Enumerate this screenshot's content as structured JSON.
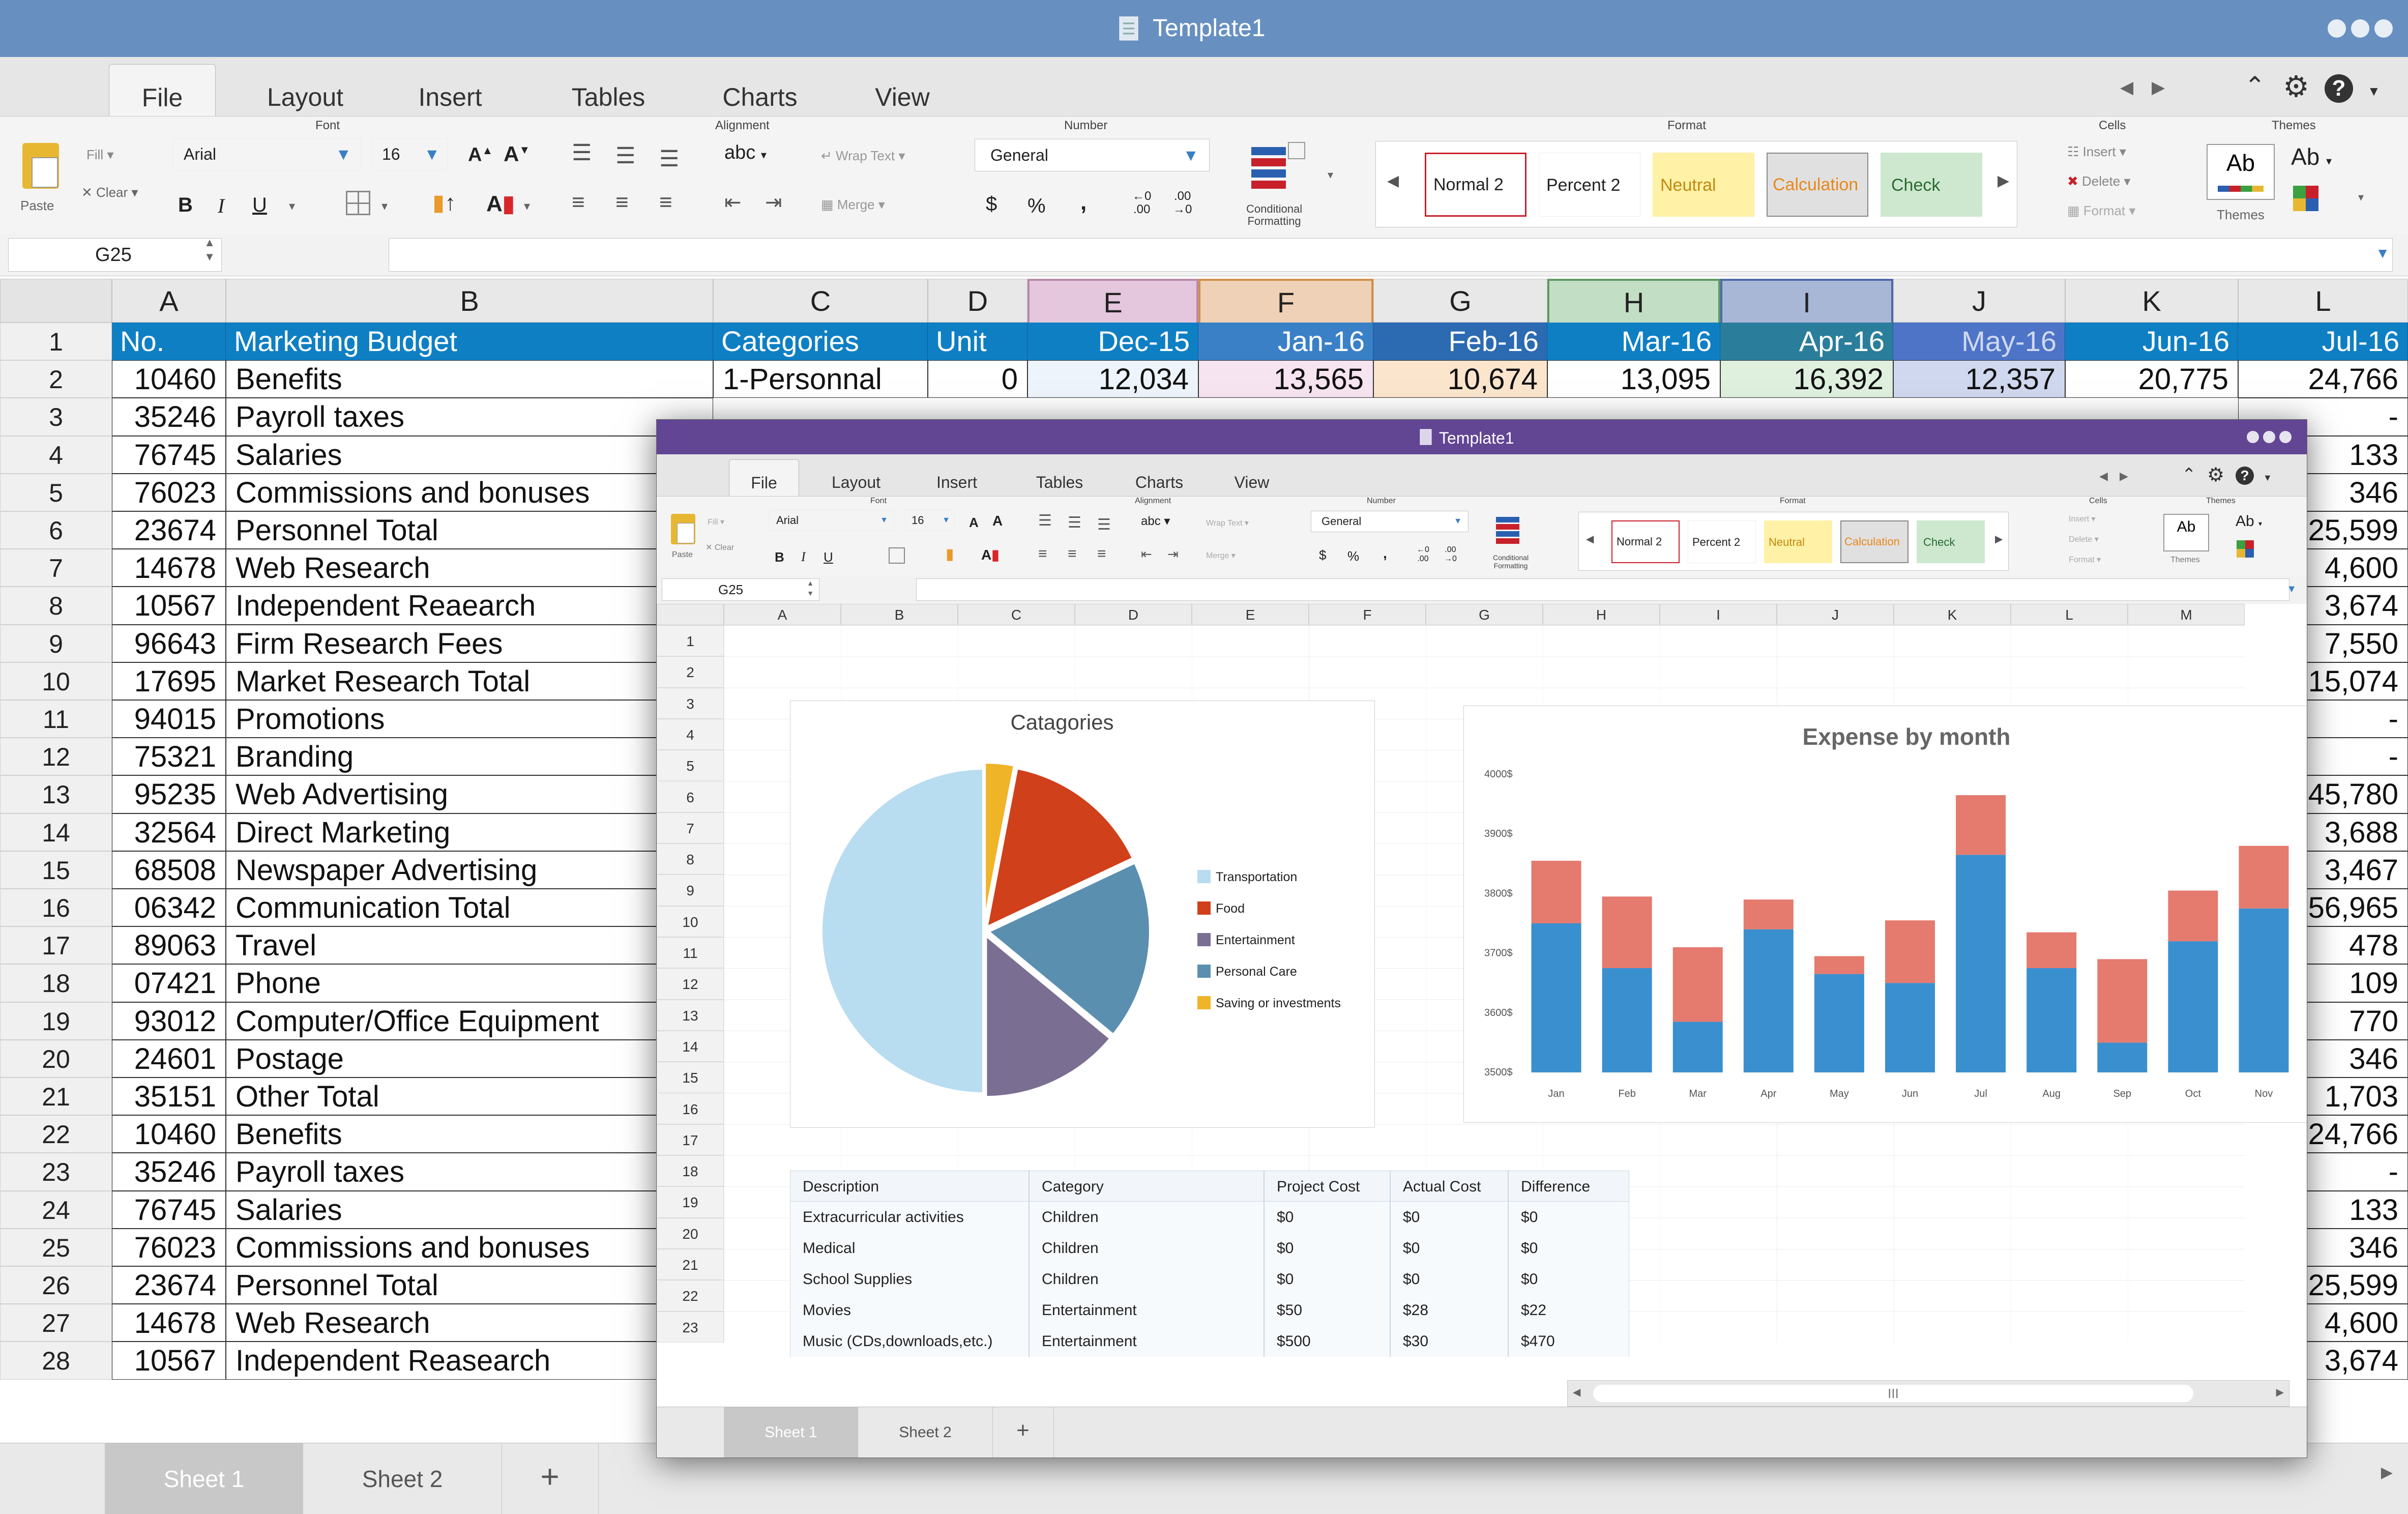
{
  "main": {
    "title": "Template1",
    "tabs": [
      "File",
      "Layout",
      "Insert",
      "Tables",
      "Charts",
      "View"
    ],
    "ribbon": {
      "group_labels": {
        "font": "Font",
        "alignment": "Alignment",
        "number": "Number",
        "format": "Format",
        "cells": "Cells",
        "themes": "Themes"
      },
      "paste_label": "Paste",
      "fill_label": "Fill",
      "clear_label": "Clear",
      "font_family": "Arial",
      "font_size": "16",
      "wrap_label": "Wrap Text",
      "merge_label": "Merge",
      "orient_label": "abc",
      "number_format": "General",
      "cond_label_1": "Conditional",
      "cond_label_2": "Formatting",
      "styles": [
        "Normal 2",
        "Percent 2",
        "Neutral",
        "Calculation",
        "Check"
      ],
      "insert_label": "Insert",
      "delete_label": "Delete",
      "format_label": "Format",
      "themes_label": "Themes",
      "ab_label": "Ab"
    },
    "name_box": "G25",
    "columns": [
      "A",
      "B",
      "C",
      "D",
      "E",
      "F",
      "G",
      "H",
      "I",
      "J",
      "K",
      "L"
    ],
    "row_numbers": [
      "1",
      "2",
      "3",
      "4",
      "5",
      "6",
      "7",
      "8",
      "9",
      "10",
      "11",
      "12",
      "13",
      "14",
      "15",
      "16",
      "17",
      "18",
      "19",
      "20",
      "21",
      "22",
      "23",
      "24",
      "25",
      "26",
      "27",
      "28"
    ],
    "header_row": [
      "No.",
      "Marketing Budget",
      "Categories",
      "Unit",
      "Dec-15",
      "Jan-16",
      "Feb-16",
      "Mar-16",
      "Apr-16",
      "May-16",
      "Jun-16",
      "Jul-16"
    ],
    "row2": [
      "10460",
      "Benefits",
      "1-Personnal",
      "0",
      "12,034",
      "13,565",
      "10,674",
      "13,095",
      "16,392",
      "12,357",
      "20,775",
      "24,766"
    ],
    "col_a": [
      "35246",
      "76745",
      "76023",
      "23674",
      "14678",
      "10567",
      "96643",
      "17695",
      "94015",
      "75321",
      "95235",
      "32564",
      "68508",
      "06342",
      "89063",
      "07421",
      "93012",
      "24601",
      "35151",
      "10460",
      "35246",
      "76745",
      "76023",
      "23674",
      "14678",
      "10567"
    ],
    "col_b": [
      "Payroll taxes",
      "Salaries",
      "Commissions and bonuses",
      "Personnel Total",
      "Web Research",
      "Independent Reaearch",
      "Firm Research Fees",
      "Market Research Total",
      "Promotions",
      "Branding",
      "Web Advertising",
      "Direct Marketing",
      "Newspaper Advertising",
      "Communication Total",
      "Travel",
      "Phone",
      "Computer/Office Equipment",
      "Postage",
      "Other Total",
      "Benefits",
      "Payroll taxes",
      "Salaries",
      "Commissions and bonuses",
      "Personnel Total",
      "Web Research",
      "Independent Reasearch"
    ],
    "col_l": [
      "-",
      "133",
      "346",
      "25,599",
      "4,600",
      "3,674",
      "7,550",
      "15,074",
      "-",
      "-",
      "45,780",
      "3,688",
      "3,467",
      "56,965",
      "478",
      "109",
      "770",
      "346",
      "1,703",
      "24,766",
      "-",
      "133",
      "346",
      "25,599",
      "4,600",
      "3,674"
    ],
    "sheet_tabs": [
      "Sheet 1",
      "Sheet 2"
    ],
    "add_sheet": "+"
  },
  "inner": {
    "title": "Template1",
    "name_box": "G25",
    "columns": [
      "A",
      "B",
      "C",
      "D",
      "E",
      "F",
      "G",
      "H",
      "I",
      "J",
      "K",
      "L",
      "M"
    ],
    "rows": [
      "1",
      "2",
      "3",
      "4",
      "5",
      "6",
      "7",
      "8",
      "9",
      "10",
      "11",
      "12",
      "13",
      "14",
      "15",
      "16",
      "17",
      "18",
      "19",
      "20",
      "21",
      "22",
      "23"
    ],
    "table": {
      "headers": [
        "Description",
        "Category",
        "Project Cost",
        "Actual Cost",
        "Difference"
      ],
      "rows": [
        [
          "Extracurricular activities",
          "Children",
          "$0",
          "$0",
          "$0"
        ],
        [
          "Medical",
          "Children",
          "$0",
          "$0",
          "$0"
        ],
        [
          "School Supplies",
          "Children",
          "$0",
          "$0",
          "$0"
        ],
        [
          "Movies",
          "Entertainment",
          "$50",
          "$28",
          "$22"
        ],
        [
          "Music (CDs,downloads,etc.)",
          "Entertainment",
          "$500",
          "$30",
          "$470"
        ]
      ]
    },
    "sheet_tabs": [
      "Sheet 1",
      "Sheet 2"
    ],
    "add_sheet": "+",
    "scroll_grip": "III"
  },
  "chart_data": [
    {
      "type": "pie",
      "title": "Catagories",
      "categories": [
        "Transportation",
        "Food",
        "Entertainment",
        "Personal Care",
        "Saving or investments"
      ],
      "values": [
        50,
        15,
        14,
        18,
        3
      ],
      "colors": [
        "#b8dcf0",
        "#d0401a",
        "#7a6f92",
        "#5a8fb0",
        "#f0b429"
      ]
    },
    {
      "type": "bar",
      "title": "Expense by month",
      "stacked": true,
      "categories": [
        "Jan",
        "Feb",
        "Mar",
        "Apr",
        "May",
        "Jun",
        "Jul",
        "Aug",
        "Sep",
        "Oct",
        "Nov"
      ],
      "y_ticks": [
        "3500$",
        "3600$",
        "3700$",
        "3800$",
        "3900$",
        "4000$"
      ],
      "ylim": [
        3500,
        4000
      ],
      "series": [
        {
          "values": [
            3750,
            3675,
            3585,
            3740,
            3665,
            3650,
            3865,
            3675,
            3550,
            3720,
            3775
          ],
          "color": "#3a8fce"
        },
        {
          "values": [
            105,
            120,
            125,
            50,
            30,
            105,
            100,
            60,
            140,
            85,
            105
          ],
          "color": "#e57a6f"
        }
      ]
    }
  ],
  "colors": {
    "header_blue": "#0f7fc4",
    "title_blue": "#6790c0",
    "inner_title_purple": "#624593"
  }
}
